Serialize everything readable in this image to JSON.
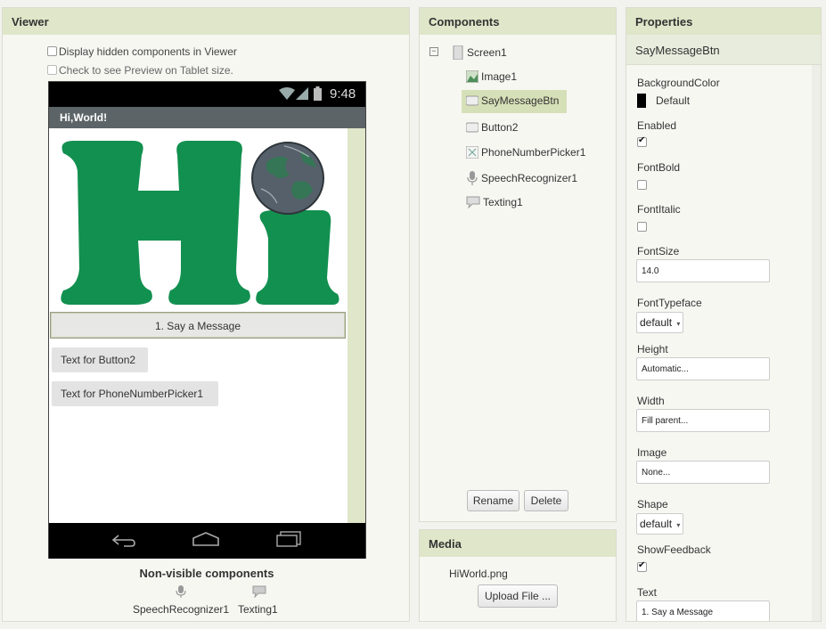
{
  "viewer": {
    "title": "Viewer",
    "opt_hidden": "Display hidden components in Viewer",
    "opt_tablet": "Check to see Preview on Tablet size.",
    "phone": {
      "time": "9:48",
      "app_title": "Hi,World!",
      "say_btn": "1. Say a Message",
      "button2": "Text for Button2",
      "picker": "Text for PhoneNumberPicker1"
    },
    "nonvisible_title": "Non-visible components",
    "nonvisible_items": [
      "SpeechRecognizer1",
      "Texting1"
    ]
  },
  "components": {
    "title": "Components",
    "items": [
      "Screen1",
      "Image1",
      "SayMessageBtn",
      "Button2",
      "PhoneNumberPicker1",
      "SpeechRecognizer1",
      "Texting1"
    ],
    "rename": "Rename",
    "delete": "Delete"
  },
  "media": {
    "title": "Media",
    "file": "HiWorld.png",
    "upload": "Upload File ..."
  },
  "properties": {
    "title": "Properties",
    "component": "SayMessageBtn",
    "background_color_label": "BackgroundColor",
    "background_color_value": "Default",
    "enabled_label": "Enabled",
    "enabled": true,
    "fontbold_label": "FontBold",
    "fontbold": false,
    "fontitalic_label": "FontItalic",
    "fontitalic": false,
    "fontsize_label": "FontSize",
    "fontsize_value": "14.0",
    "fonttypeface_label": "FontTypeface",
    "fonttypeface_value": "default",
    "height_label": "Height",
    "height_value": "Automatic...",
    "width_label": "Width",
    "width_value": "Fill parent...",
    "image_label": "Image",
    "image_value": "None...",
    "shape_label": "Shape",
    "shape_value": "default",
    "showfeedback_label": "ShowFeedback",
    "showfeedback": true,
    "text_label": "Text",
    "text_value": "1. Say a Message"
  },
  "colors": {
    "header_bg": "#dfe6c9",
    "selected_bg": "#d6e0b8",
    "hi_green": "#12904f",
    "phone_title_bar": "#5d6468"
  }
}
